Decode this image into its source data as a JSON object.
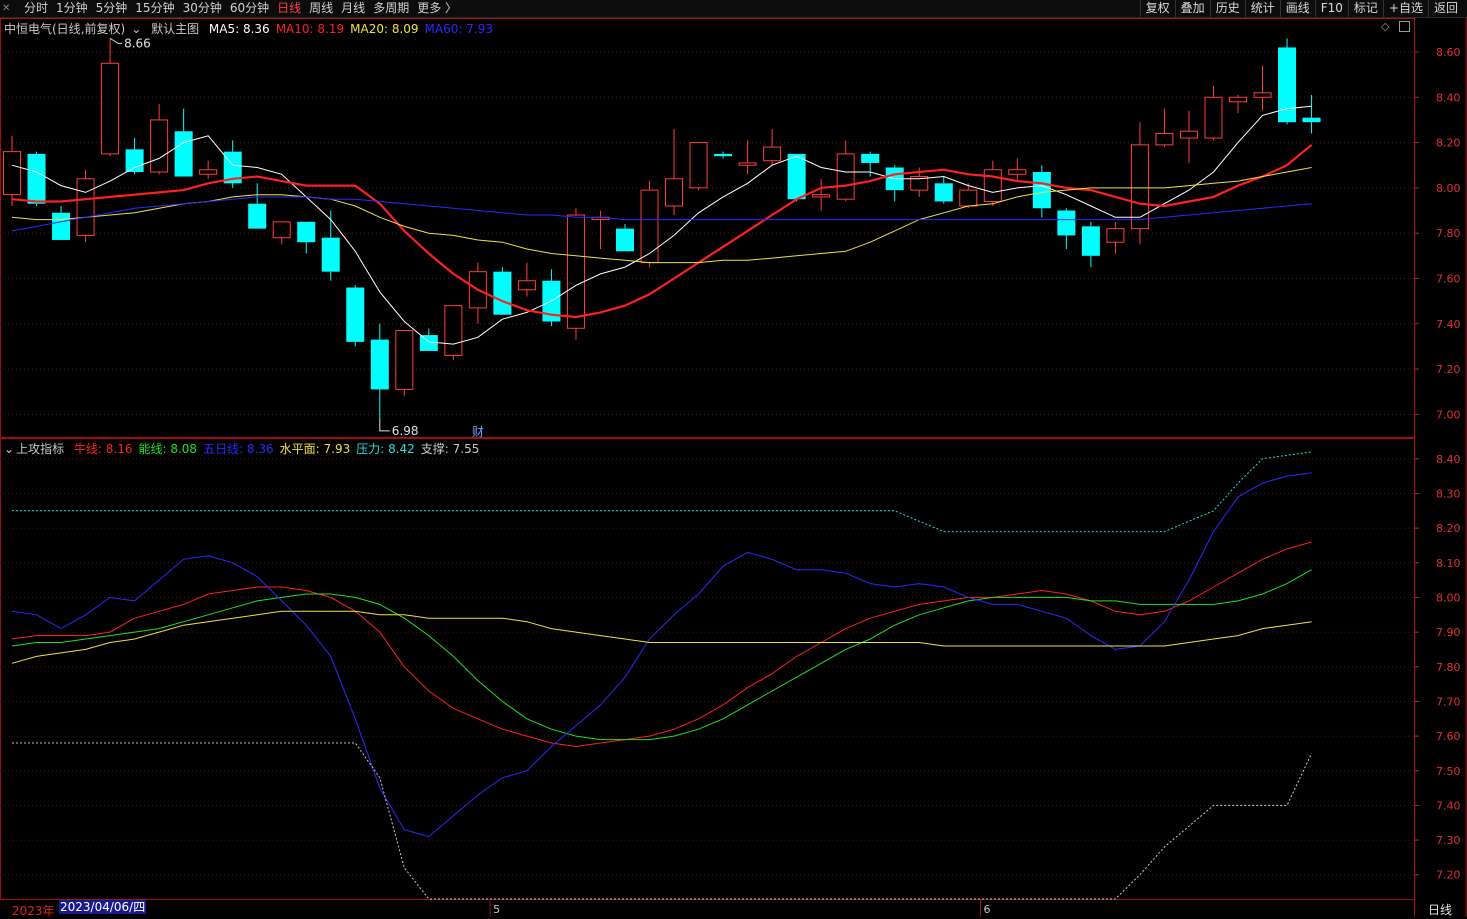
{
  "toolbar": {
    "tabs": [
      "分时",
      "1分钟",
      "5分钟",
      "15分钟",
      "30分钟",
      "60分钟",
      "日线",
      "周线",
      "月线",
      "多周期",
      "更多 〉"
    ],
    "active_tab": "日线",
    "right_tools": [
      "复权",
      "叠加",
      "历史",
      "统计",
      "画线",
      "F10",
      "标记",
      "+自选",
      "返回"
    ]
  },
  "main": {
    "stock_label": "中恒电气(日线,前复权)",
    "template_label": "默认主图",
    "ma": [
      {
        "label": "MA5: 8.36",
        "color": "#ffffff"
      },
      {
        "label": "MA10: 8.19",
        "color": "#ff2020"
      },
      {
        "label": "MA20: 8.09",
        "color": "#f0e040"
      },
      {
        "label": "MA60: 7.93",
        "color": "#2a2aff"
      }
    ],
    "high_marker": "8.66",
    "low_marker": "6.98",
    "fin_marker": "财"
  },
  "indicator": {
    "name": "上攻指标",
    "items": [
      {
        "label": "牛线: 8.16",
        "color": "#ff2020"
      },
      {
        "label": "能线: 8.08",
        "color": "#20e020"
      },
      {
        "label": "五日线: 8.36",
        "color": "#2a2aff"
      },
      {
        "label": "水平面: 7.93",
        "color": "#f0e040"
      },
      {
        "label": "压力: 8.42",
        "color": "#20e0e0"
      },
      {
        "label": "支撑: 7.55",
        "color": "#c8c8c8"
      }
    ]
  },
  "footer": {
    "year": "2023年",
    "date": "2023/04/06/四",
    "month_labels": [
      "5",
      "6"
    ],
    "period": "日线"
  },
  "chart_data": [
    {
      "type": "candlestick",
      "title": "中恒电气(日线,前复权)",
      "x_start": "2023/04/06",
      "ylim": [
        6.9,
        8.75
      ],
      "y_ticks": [
        8.6,
        8.4,
        8.2,
        8.0,
        7.8,
        7.6,
        7.4,
        7.2,
        7.0
      ],
      "up_color": "#ff3c3c",
      "down_color": "#00ffff",
      "candles": [
        {
          "o": 7.97,
          "h": 8.23,
          "l": 7.92,
          "c": 8.16
        },
        {
          "o": 8.15,
          "h": 8.16,
          "l": 7.92,
          "c": 7.93
        },
        {
          "o": 7.89,
          "h": 7.92,
          "l": 7.77,
          "c": 7.77
        },
        {
          "o": 7.79,
          "h": 8.08,
          "l": 7.76,
          "c": 8.04
        },
        {
          "o": 8.15,
          "h": 8.66,
          "l": 8.14,
          "c": 8.55
        },
        {
          "o": 8.17,
          "h": 8.22,
          "l": 8.06,
          "c": 8.07
        },
        {
          "o": 8.07,
          "h": 8.37,
          "l": 8.06,
          "c": 8.3
        },
        {
          "o": 8.25,
          "h": 8.35,
          "l": 8.05,
          "c": 8.05
        },
        {
          "o": 8.06,
          "h": 8.12,
          "l": 8.04,
          "c": 8.08
        },
        {
          "o": 8.16,
          "h": 8.21,
          "l": 8.0,
          "c": 8.02
        },
        {
          "o": 7.93,
          "h": 8.02,
          "l": 7.82,
          "c": 7.82
        },
        {
          "o": 7.78,
          "h": 7.85,
          "l": 7.75,
          "c": 7.85
        },
        {
          "o": 7.85,
          "h": 7.85,
          "l": 7.71,
          "c": 7.76
        },
        {
          "o": 7.78,
          "h": 7.9,
          "l": 7.59,
          "c": 7.63
        },
        {
          "o": 7.56,
          "h": 7.57,
          "l": 7.3,
          "c": 7.32
        },
        {
          "o": 7.33,
          "h": 7.4,
          "l": 6.98,
          "c": 7.11
        },
        {
          "o": 7.11,
          "h": 7.37,
          "l": 7.08,
          "c": 7.37
        },
        {
          "o": 7.35,
          "h": 7.38,
          "l": 7.28,
          "c": 7.28
        },
        {
          "o": 7.26,
          "h": 7.48,
          "l": 7.24,
          "c": 7.48
        },
        {
          "o": 7.47,
          "h": 7.67,
          "l": 7.4,
          "c": 7.63
        },
        {
          "o": 7.63,
          "h": 7.65,
          "l": 7.44,
          "c": 7.44
        },
        {
          "o": 7.55,
          "h": 7.67,
          "l": 7.52,
          "c": 7.59
        },
        {
          "o": 7.59,
          "h": 7.64,
          "l": 7.39,
          "c": 7.41
        },
        {
          "o": 7.38,
          "h": 7.91,
          "l": 7.33,
          "c": 7.88
        },
        {
          "o": 7.86,
          "h": 7.9,
          "l": 7.73,
          "c": 7.87
        },
        {
          "o": 7.82,
          "h": 7.84,
          "l": 7.72,
          "c": 7.72
        },
        {
          "o": 7.67,
          "h": 8.03,
          "l": 7.65,
          "c": 7.99
        },
        {
          "o": 7.92,
          "h": 8.26,
          "l": 7.88,
          "c": 8.04
        },
        {
          "o": 8.0,
          "h": 8.2,
          "l": 7.99,
          "c": 8.2
        },
        {
          "o": 8.15,
          "h": 8.16,
          "l": 8.13,
          "c": 8.14
        },
        {
          "o": 8.1,
          "h": 8.21,
          "l": 8.06,
          "c": 8.11
        },
        {
          "o": 8.12,
          "h": 8.26,
          "l": 8.1,
          "c": 8.18
        },
        {
          "o": 8.15,
          "h": 8.15,
          "l": 7.94,
          "c": 7.95
        },
        {
          "o": 7.96,
          "h": 8.04,
          "l": 7.9,
          "c": 7.97
        },
        {
          "o": 7.95,
          "h": 8.21,
          "l": 7.94,
          "c": 8.15
        },
        {
          "o": 8.15,
          "h": 8.16,
          "l": 8.05,
          "c": 8.11
        },
        {
          "o": 8.09,
          "h": 8.1,
          "l": 7.94,
          "c": 7.99
        },
        {
          "o": 7.99,
          "h": 8.09,
          "l": 7.96,
          "c": 8.05
        },
        {
          "o": 8.02,
          "h": 8.05,
          "l": 7.93,
          "c": 7.94
        },
        {
          "o": 7.92,
          "h": 8.02,
          "l": 7.91,
          "c": 7.99
        },
        {
          "o": 7.94,
          "h": 8.12,
          "l": 7.92,
          "c": 8.08
        },
        {
          "o": 8.06,
          "h": 8.13,
          "l": 8.03,
          "c": 8.08
        },
        {
          "o": 8.07,
          "h": 8.1,
          "l": 7.87,
          "c": 7.91
        },
        {
          "o": 7.9,
          "h": 7.91,
          "l": 7.73,
          "c": 7.79
        },
        {
          "o": 7.83,
          "h": 7.85,
          "l": 7.65,
          "c": 7.7
        },
        {
          "o": 7.76,
          "h": 7.85,
          "l": 7.71,
          "c": 7.82
        },
        {
          "o": 7.82,
          "h": 8.29,
          "l": 7.75,
          "c": 8.19
        },
        {
          "o": 8.19,
          "h": 8.35,
          "l": 8.18,
          "c": 8.24
        },
        {
          "o": 8.22,
          "h": 8.34,
          "l": 8.11,
          "c": 8.25
        },
        {
          "o": 8.22,
          "h": 8.45,
          "l": 8.21,
          "c": 8.4
        },
        {
          "o": 8.38,
          "h": 8.41,
          "l": 8.33,
          "c": 8.4
        },
        {
          "o": 8.4,
          "h": 8.54,
          "l": 8.34,
          "c": 8.42
        },
        {
          "o": 8.62,
          "h": 8.66,
          "l": 8.28,
          "c": 8.29
        },
        {
          "o": 8.31,
          "h": 8.41,
          "l": 8.24,
          "c": 8.29
        }
      ],
      "series": [
        {
          "name": "MA5",
          "color": "#ffffff",
          "values": [
            8.1,
            8.07,
            8.01,
            7.98,
            8.03,
            8.09,
            8.13,
            8.2,
            8.23,
            8.1,
            8.09,
            8.06,
            7.96,
            7.86,
            7.72,
            7.54,
            7.41,
            7.32,
            7.31,
            7.34,
            7.42,
            7.45,
            7.5,
            7.57,
            7.62,
            7.65,
            7.71,
            7.79,
            7.89,
            7.96,
            8.02,
            8.1,
            8.14,
            8.09,
            8.07,
            8.07,
            8.04,
            8.04,
            8.05,
            8.01,
            7.98,
            8.0,
            8.01,
            7.97,
            7.92,
            7.87,
            7.87,
            7.93,
            7.99,
            8.07,
            8.2,
            8.32,
            8.35,
            8.36
          ]
        },
        {
          "name": "MA10",
          "color": "#ff2020",
          "values": [
            7.95,
            7.94,
            7.94,
            7.95,
            7.96,
            7.97,
            7.98,
            7.99,
            8.02,
            8.04,
            8.05,
            8.03,
            8.01,
            8.01,
            8.01,
            7.93,
            7.81,
            7.71,
            7.62,
            7.55,
            7.5,
            7.46,
            7.44,
            7.43,
            7.45,
            7.48,
            7.53,
            7.6,
            7.67,
            7.74,
            7.81,
            7.88,
            7.95,
            8.0,
            8.01,
            8.03,
            8.06,
            8.07,
            8.08,
            8.06,
            8.05,
            8.03,
            8.02,
            8.0,
            7.99,
            7.96,
            7.93,
            7.92,
            7.94,
            7.96,
            8.01,
            8.05,
            8.1,
            8.19
          ]
        },
        {
          "name": "MA20",
          "color": "#f0e040",
          "values": [
            7.87,
            7.86,
            7.86,
            7.87,
            7.88,
            7.89,
            7.91,
            7.93,
            7.94,
            7.96,
            7.97,
            7.97,
            7.96,
            7.95,
            7.92,
            7.87,
            7.83,
            7.8,
            7.79,
            7.77,
            7.76,
            7.73,
            7.71,
            7.7,
            7.69,
            7.68,
            7.67,
            7.67,
            7.67,
            7.68,
            7.68,
            7.69,
            7.7,
            7.71,
            7.72,
            7.76,
            7.81,
            7.86,
            7.89,
            7.92,
            7.93,
            7.96,
            7.98,
            7.99,
            8.0,
            8.0,
            8.0,
            8.0,
            8.01,
            8.02,
            8.03,
            8.05,
            8.07,
            8.09
          ]
        },
        {
          "name": "MA60",
          "color": "#2a2aff",
          "values": [
            7.81,
            7.83,
            7.85,
            7.87,
            7.89,
            7.91,
            7.92,
            7.93,
            7.94,
            7.95,
            7.96,
            7.96,
            7.96,
            7.95,
            7.95,
            7.94,
            7.93,
            7.92,
            7.91,
            7.9,
            7.89,
            7.88,
            7.88,
            7.87,
            7.87,
            7.86,
            7.86,
            7.86,
            7.86,
            7.86,
            7.86,
            7.86,
            7.86,
            7.86,
            7.86,
            7.86,
            7.86,
            7.86,
            7.86,
            7.86,
            7.86,
            7.86,
            7.86,
            7.86,
            7.86,
            7.86,
            7.86,
            7.87,
            7.88,
            7.89,
            7.9,
            7.91,
            7.92,
            7.93
          ]
        }
      ]
    },
    {
      "type": "line",
      "title": "上攻指标",
      "ylim": [
        7.13,
        8.46
      ],
      "y_ticks": [
        8.4,
        8.3,
        8.2,
        8.1,
        8.0,
        7.9,
        7.8,
        7.7,
        7.6,
        7.5,
        7.4,
        7.3,
        7.2
      ],
      "series": [
        {
          "name": "牛线",
          "color": "#ff2020",
          "style": "solid",
          "values": [
            7.88,
            7.89,
            7.89,
            7.89,
            7.9,
            7.94,
            7.96,
            7.98,
            8.01,
            8.02,
            8.03,
            8.03,
            8.02,
            8.0,
            7.96,
            7.9,
            7.8,
            7.73,
            7.68,
            7.65,
            7.62,
            7.6,
            7.58,
            7.57,
            7.58,
            7.59,
            7.6,
            7.62,
            7.65,
            7.69,
            7.74,
            7.78,
            7.83,
            7.87,
            7.91,
            7.94,
            7.96,
            7.98,
            7.99,
            8.0,
            8.0,
            8.01,
            8.02,
            8.01,
            7.99,
            7.96,
            7.95,
            7.96,
            7.99,
            8.03,
            8.07,
            8.11,
            8.14,
            8.16
          ]
        },
        {
          "name": "能线",
          "color": "#20e020",
          "style": "solid",
          "values": [
            7.86,
            7.87,
            7.87,
            7.88,
            7.89,
            7.9,
            7.91,
            7.93,
            7.95,
            7.97,
            7.99,
            8.0,
            8.01,
            8.01,
            8.0,
            7.98,
            7.94,
            7.89,
            7.83,
            7.76,
            7.7,
            7.65,
            7.62,
            7.6,
            7.59,
            7.59,
            7.59,
            7.6,
            7.62,
            7.65,
            7.69,
            7.73,
            7.77,
            7.81,
            7.85,
            7.88,
            7.92,
            7.95,
            7.97,
            7.99,
            8.0,
            8.0,
            8.0,
            8.0,
            7.99,
            7.99,
            7.98,
            7.98,
            7.98,
            7.98,
            7.99,
            8.01,
            8.04,
            8.08
          ]
        },
        {
          "name": "五日线",
          "color": "#2a2aff",
          "style": "solid",
          "values": [
            7.96,
            7.95,
            7.91,
            7.95,
            8.0,
            7.99,
            8.05,
            8.11,
            8.12,
            8.1,
            8.06,
            7.99,
            7.92,
            7.83,
            7.65,
            7.45,
            7.33,
            7.31,
            7.37,
            7.43,
            7.48,
            7.5,
            7.57,
            7.63,
            7.69,
            7.77,
            7.88,
            7.95,
            8.01,
            8.09,
            8.13,
            8.11,
            8.08,
            8.08,
            8.07,
            8.04,
            8.03,
            8.04,
            8.03,
            8.0,
            7.98,
            7.98,
            7.96,
            7.94,
            7.89,
            7.85,
            7.86,
            7.93,
            8.05,
            8.19,
            8.29,
            8.33,
            8.35,
            8.36
          ]
        },
        {
          "name": "水平面",
          "color": "#f0e040",
          "style": "solid",
          "values": [
            7.81,
            7.83,
            7.84,
            7.85,
            7.87,
            7.88,
            7.9,
            7.92,
            7.93,
            7.94,
            7.95,
            7.96,
            7.96,
            7.96,
            7.96,
            7.95,
            7.95,
            7.94,
            7.94,
            7.94,
            7.94,
            7.93,
            7.91,
            7.9,
            7.89,
            7.88,
            7.87,
            7.87,
            7.87,
            7.87,
            7.87,
            7.87,
            7.87,
            7.87,
            7.87,
            7.87,
            7.87,
            7.87,
            7.86,
            7.86,
            7.86,
            7.86,
            7.86,
            7.86,
            7.86,
            7.86,
            7.86,
            7.86,
            7.87,
            7.88,
            7.89,
            7.91,
            7.92,
            7.93
          ]
        },
        {
          "name": "压力",
          "color": "#20e0e0",
          "style": "dashed",
          "values": [
            8.25,
            8.25,
            8.25,
            8.25,
            8.25,
            8.25,
            8.25,
            8.25,
            8.25,
            8.25,
            8.25,
            8.25,
            8.25,
            8.25,
            8.25,
            8.25,
            8.25,
            8.25,
            8.25,
            8.25,
            8.25,
            8.25,
            8.25,
            8.25,
            8.25,
            8.25,
            8.25,
            8.25,
            8.25,
            8.25,
            8.25,
            8.25,
            8.25,
            8.25,
            8.25,
            8.25,
            8.25,
            8.22,
            8.19,
            8.19,
            8.19,
            8.19,
            8.19,
            8.19,
            8.19,
            8.19,
            8.19,
            8.19,
            8.22,
            8.25,
            8.33,
            8.4,
            8.41,
            8.42
          ]
        },
        {
          "name": "支撑",
          "color": "#c8c8c8",
          "style": "dashed",
          "values": [
            7.58,
            7.58,
            7.58,
            7.58,
            7.58,
            7.58,
            7.58,
            7.58,
            7.58,
            7.58,
            7.58,
            7.58,
            7.58,
            7.58,
            7.58,
            7.48,
            7.22,
            7.13,
            7.13,
            7.13,
            7.13,
            7.13,
            7.13,
            7.13,
            7.13,
            7.13,
            7.13,
            7.13,
            7.13,
            7.13,
            7.13,
            7.13,
            7.13,
            7.13,
            7.13,
            7.13,
            7.13,
            7.13,
            7.13,
            7.13,
            7.13,
            7.13,
            7.13,
            7.13,
            7.13,
            7.13,
            7.2,
            7.28,
            7.34,
            7.4,
            7.4,
            7.4,
            7.4,
            7.55
          ]
        }
      ]
    }
  ]
}
